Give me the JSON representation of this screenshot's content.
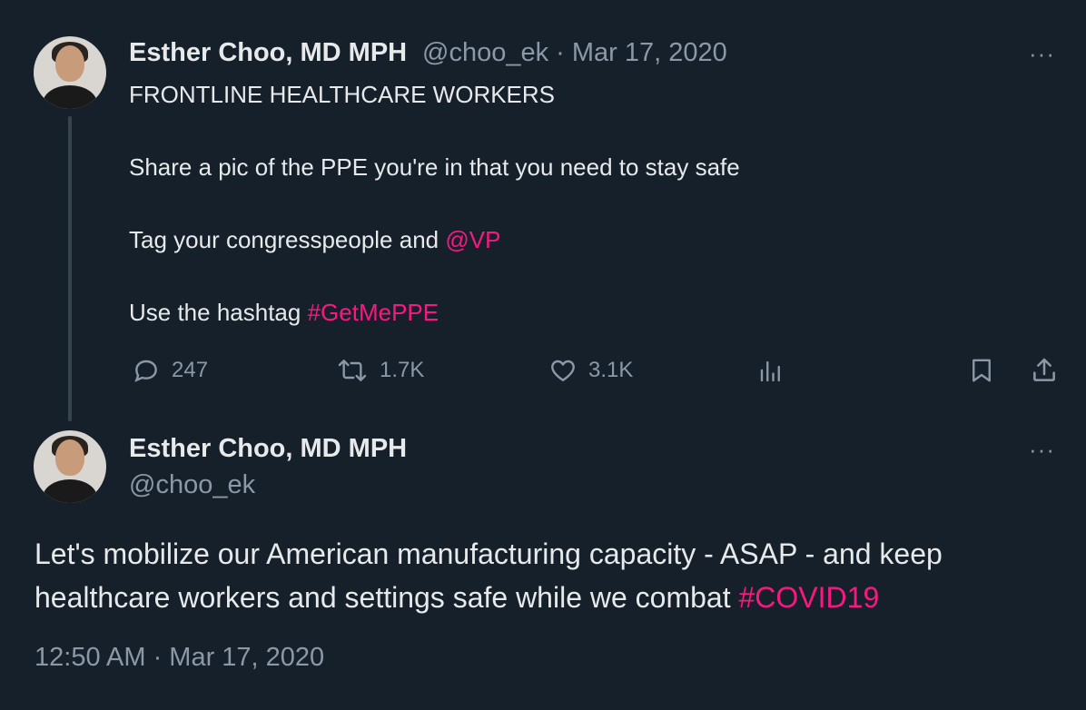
{
  "tweet1": {
    "author_name": "Esther Choo, MD MPH",
    "handle": "@choo_ek",
    "separator": "·",
    "date": "Mar 17, 2020",
    "line1": "FRONTLINE HEALTHCARE WORKERS",
    "line2": "Share a pic of the PPE you're in that you need to stay safe",
    "line3_prefix": "Tag your congresspeople and ",
    "line3_mention": "@VP",
    "line4_prefix": "Use the hashtag ",
    "line4_hashtag": "#GetMePPE",
    "actions": {
      "replies": "247",
      "retweets": "1.7K",
      "likes": "3.1K"
    },
    "more_label": "···"
  },
  "tweet2": {
    "author_name": "Esther Choo, MD MPH",
    "handle": "@choo_ek",
    "text_prefix": "Let's mobilize our American manufacturing capacity - ASAP - and keep healthcare workers and settings safe while we combat ",
    "hashtag": "#COVID19",
    "timestamp": "12:50 AM · Mar 17, 2020",
    "more_label": "···"
  },
  "colors": {
    "background": "#15202b",
    "text": "#e7e9ea",
    "muted": "#8b98a5",
    "accent": "#f91880"
  },
  "icons": {
    "reply": "speech-bubble-icon",
    "retweet": "retweet-icon",
    "like": "heart-icon",
    "views": "bar-chart-icon",
    "bookmark": "bookmark-icon",
    "share": "share-icon"
  }
}
